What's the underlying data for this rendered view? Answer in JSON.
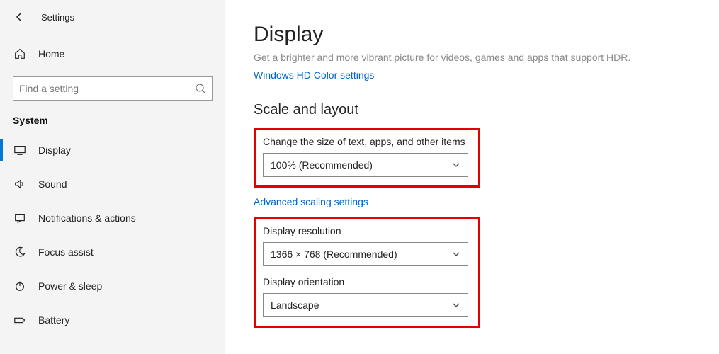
{
  "header": {
    "title": "Settings"
  },
  "sidebar": {
    "home_label": "Home",
    "search_placeholder": "Find a setting",
    "section_label": "System",
    "items": [
      {
        "label": "Display"
      },
      {
        "label": "Sound"
      },
      {
        "label": "Notifications & actions"
      },
      {
        "label": "Focus assist"
      },
      {
        "label": "Power & sleep"
      },
      {
        "label": "Battery"
      }
    ]
  },
  "main": {
    "title": "Display",
    "hdr_sub": "Get a brighter and more vibrant picture for videos, games and apps that support HDR.",
    "hdr_link": "Windows HD Color settings",
    "scale_heading": "Scale and layout",
    "scale_field_label": "Change the size of text, apps, and other items",
    "scale_value": "100% (Recommended)",
    "adv_scaling_link": "Advanced scaling settings",
    "resolution_label": "Display resolution",
    "resolution_value": "1366 × 768 (Recommended)",
    "orientation_label": "Display orientation",
    "orientation_value": "Landscape"
  }
}
